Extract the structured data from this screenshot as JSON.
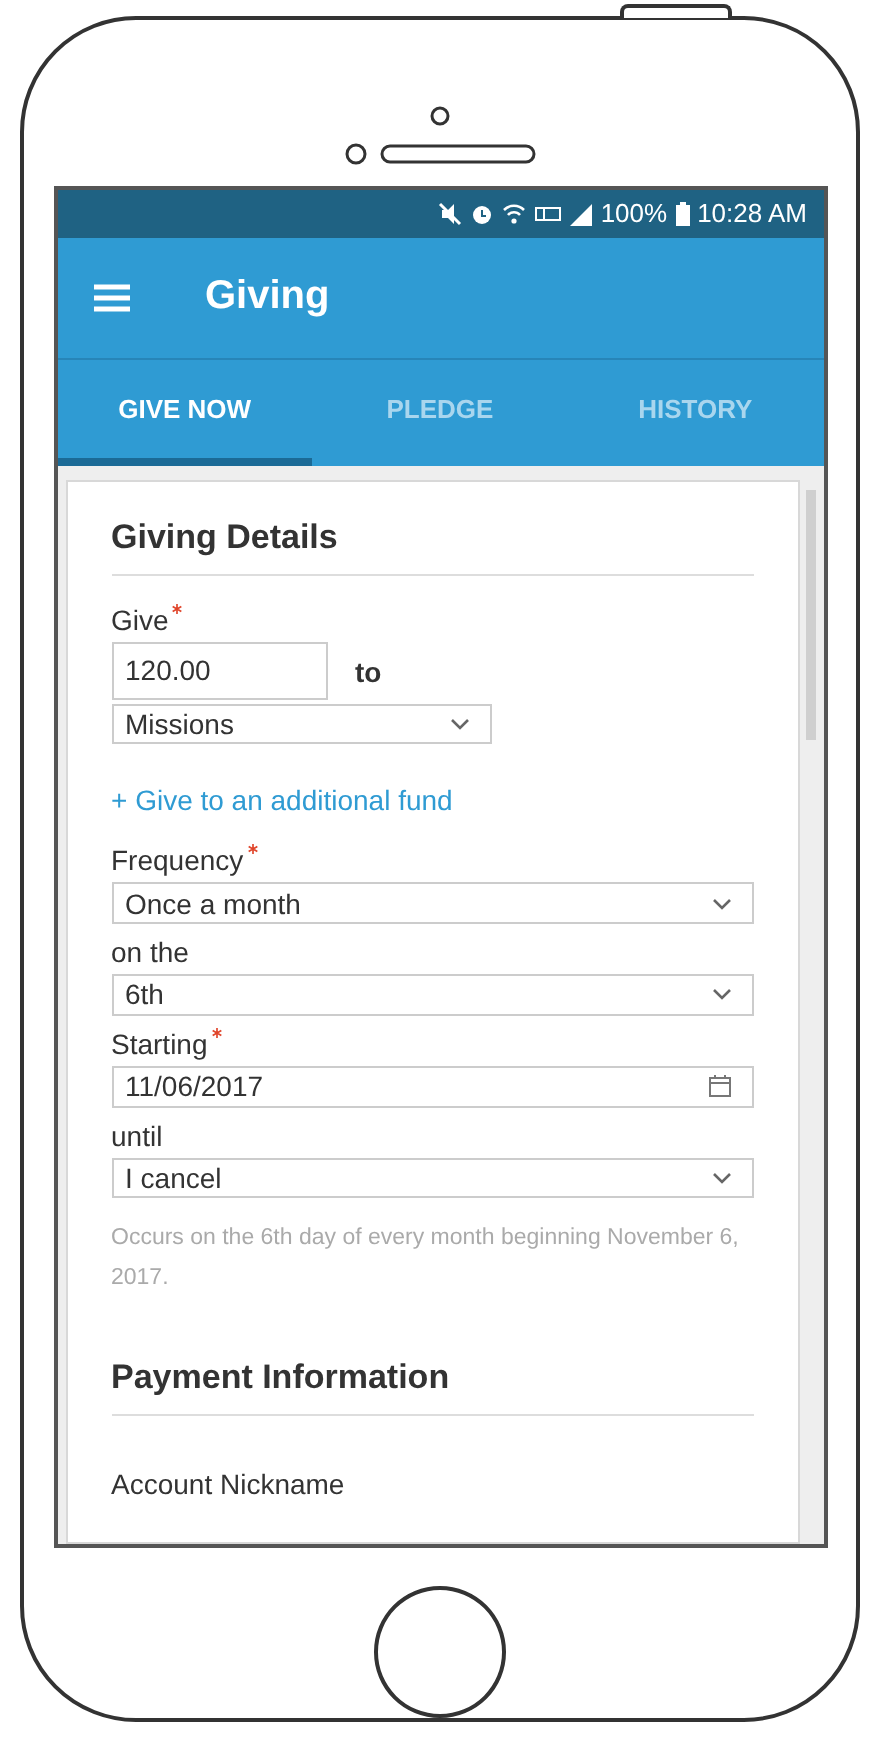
{
  "status_bar": {
    "battery": "100%",
    "time": "10:28 AM"
  },
  "app_bar": {
    "title": "Giving"
  },
  "tabs": [
    {
      "label": "GIVE NOW",
      "selected": true
    },
    {
      "label": "PLEDGE",
      "selected": false
    },
    {
      "label": "HISTORY",
      "selected": false
    }
  ],
  "giving_details": {
    "title": "Giving Details",
    "give": {
      "label": "Give",
      "required": true,
      "amount": "120.00",
      "connector": "to",
      "fund": "Missions"
    },
    "add_fund_link": "+ Give to an additional fund",
    "fields": [
      {
        "label": "Frequency",
        "required": true,
        "kind": "select",
        "value": "Once a month"
      },
      {
        "label": "on the",
        "required": false,
        "kind": "select",
        "value": "6th"
      },
      {
        "label": "Starting",
        "required": true,
        "kind": "date",
        "value": "11/06/2017"
      },
      {
        "label": "until",
        "required": false,
        "kind": "select",
        "value": "I cancel"
      }
    ],
    "summary": "Occurs on the 6th day of every month beginning November 6, 2017."
  },
  "payment_information": {
    "title": "Payment Information",
    "fields": [
      {
        "label": "Account Nickname"
      }
    ]
  }
}
